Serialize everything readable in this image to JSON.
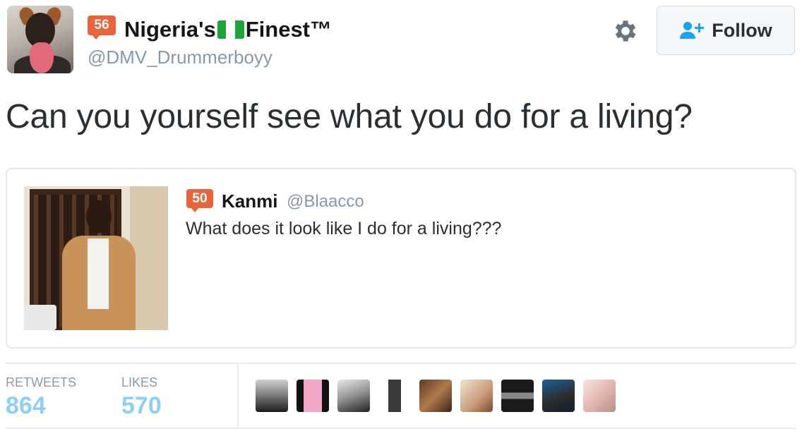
{
  "author": {
    "badge": "56",
    "name_part1": "Nigeria's",
    "name_part2": "Finest™",
    "handle": "@DMV_Drummerboyy"
  },
  "follow_button": {
    "label": "Follow"
  },
  "icons": {
    "settings": "gear-icon",
    "follow": "add-user-icon",
    "flag": "nigeria-flag-icon"
  },
  "tweet": {
    "text": "Can you yourself see what you do for a living?"
  },
  "quoted_tweet": {
    "badge": "50",
    "name": "Kanmi",
    "handle": "@Blaacco",
    "text": "What does it look like I do for a living???"
  },
  "stats": {
    "retweets_label": "RETWEETS",
    "retweets_value": "864",
    "likes_label": "LIKES",
    "likes_value": "570"
  },
  "colors": {
    "badge": "#e8643c",
    "stat_value": "#8ecdf8",
    "muted": "#8899a6",
    "flag_green": "#1fa43a"
  }
}
